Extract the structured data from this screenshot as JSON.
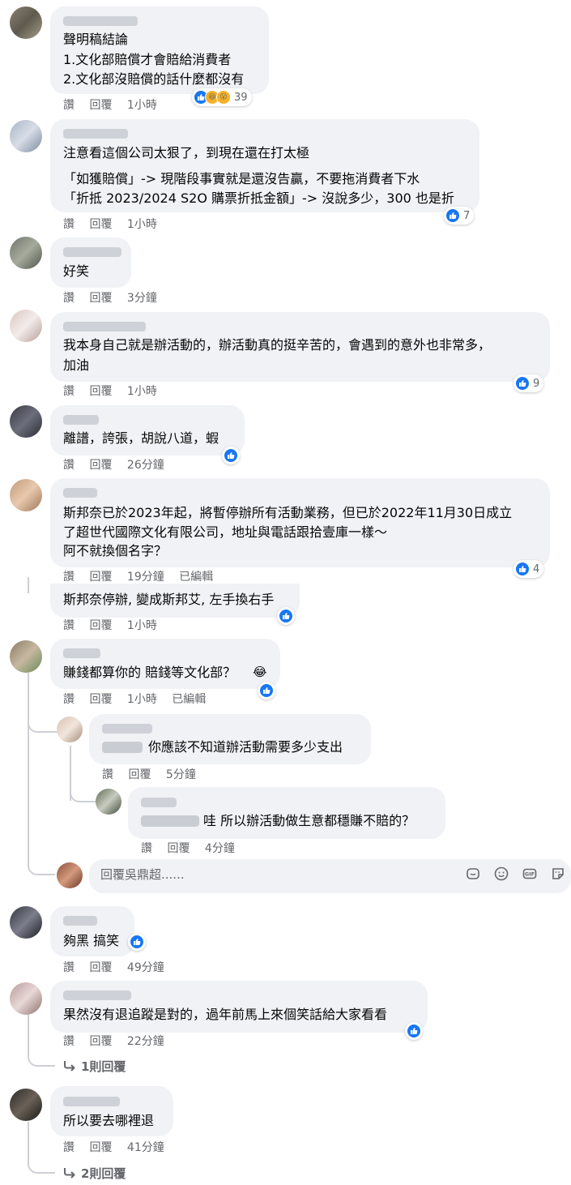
{
  "comments": [
    {
      "lines": [
        "聲明稿結論",
        "1.文化部賠償才會賠給消費者",
        "2.文化部沒賠償的話什麼都沒有"
      ],
      "actions": {
        "like": "讚",
        "reply": "回覆",
        "time": "1小時",
        "edited": ""
      },
      "reactions": "39"
    },
    {
      "lines": [
        "注意看這個公司太狠了，到現在還在打太極",
        "「如獲賠償」-> 現階段事實就是還沒告贏，不要拖消費者下水",
        "「折抵 2023/2024 S2O 購票折抵金額」-> 沒說多少，300 也是折"
      ],
      "actions": {
        "like": "讚",
        "reply": "回覆",
        "time": "1小時",
        "edited": ""
      },
      "reactions": "7"
    },
    {
      "lines": [
        "好笑"
      ],
      "actions": {
        "like": "讚",
        "reply": "回覆",
        "time": "3分鐘",
        "edited": ""
      },
      "reactions": ""
    },
    {
      "lines": [
        "我本身自己就是辦活動的，辦活動真的挺辛苦的，會遇到的意外也非常多，",
        "加油"
      ],
      "actions": {
        "like": "讚",
        "reply": "回覆",
        "time": "1小時",
        "edited": ""
      },
      "reactions": "9"
    },
    {
      "lines": [
        "離譜，誇張，胡說八道，蝦"
      ],
      "actions": {
        "like": "讚",
        "reply": "回覆",
        "time": "26分鐘",
        "edited": ""
      },
      "reactions": ""
    },
    {
      "lines": [
        "斯邦奈已於2023年起，將暫停辦所有活動業務，但已於2022年11月30日成立",
        "了超世代國際文化有限公司，地址與電話跟拾壹庫一樣～",
        "阿不就換個名字？"
      ],
      "actions": {
        "like": "讚",
        "reply": "回覆",
        "time": "19分鐘",
        "edited": "已編輯"
      },
      "reactions": "4"
    },
    {
      "lines": [
        "斯邦奈停辦, 變成斯邦艾, 左手換右手"
      ],
      "actions": {
        "like": "讚",
        "reply": "回覆",
        "time": "1小時",
        "edited": ""
      },
      "reactions": ""
    },
    {
      "lines": [
        "賺錢都算你的 賠錢等文化部？"
      ],
      "actions": {
        "like": "讚",
        "reply": "回覆",
        "time": "1小時",
        "edited": "已編輯"
      },
      "reactions": ""
    },
    {
      "lines": [
        "你應該不知道辦活動需要多少支出"
      ],
      "actions": {
        "like": "讚",
        "reply": "回覆",
        "time": "5分鐘",
        "edited": ""
      },
      "reactions": ""
    },
    {
      "lines": [
        "哇 所以辦活動做生意都穩賺不賠的？"
      ],
      "actions": {
        "like": "讚",
        "reply": "回覆",
        "time": "4分鐘",
        "edited": ""
      },
      "reactions": ""
    },
    {
      "lines": [
        "夠黑 搞笑"
      ],
      "actions": {
        "like": "讚",
        "reply": "回覆",
        "time": "49分鐘",
        "edited": ""
      },
      "reactions": ""
    },
    {
      "lines": [
        "果然沒有退追蹤是對的，過年前馬上來個笑話給大家看看"
      ],
      "actions": {
        "like": "讚",
        "reply": "回覆",
        "time": "22分鐘",
        "edited": ""
      },
      "reactions": ""
    },
    {
      "lines": [
        "所以要去哪裡退"
      ],
      "actions": {
        "like": "讚",
        "reply": "回覆",
        "time": "41分鐘",
        "edited": ""
      },
      "reactions": ""
    }
  ],
  "reply_box": {
    "placeholder": "回覆吳鼎超......"
  },
  "more_replies": [
    "1則回覆",
    "2則回覆"
  ],
  "icons": [
    "like-icon",
    "haha-icon",
    "wow-icon",
    "sticker-icon",
    "emoji-icon",
    "gif-icon",
    "comment-sticker-icon",
    "reply-arrow-icon"
  ],
  "colors": {
    "bubble": "#f0f2f5",
    "like": "#1877f2",
    "meta": "#65676b",
    "text": "#050505"
  }
}
